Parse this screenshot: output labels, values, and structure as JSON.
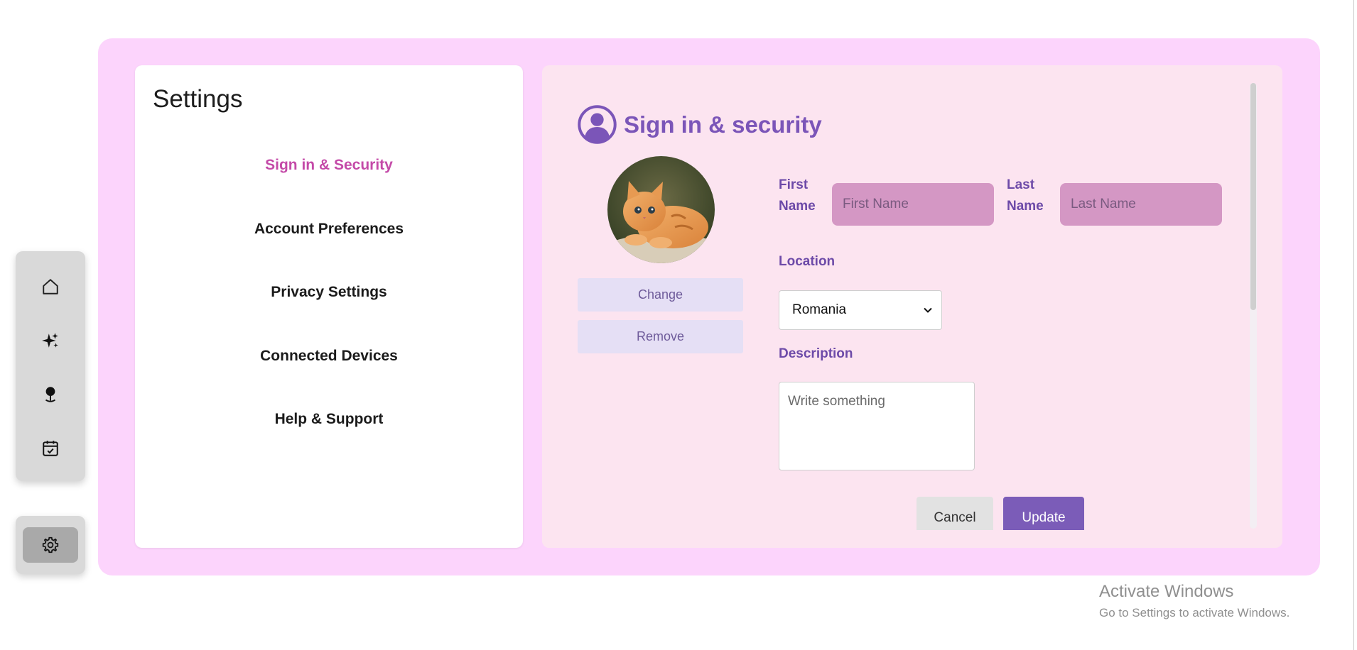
{
  "rail": {
    "icons": [
      "home-icon",
      "sparkles-icon",
      "map-pin-icon",
      "calendar-check-icon"
    ],
    "bottom_icon": "gear-icon"
  },
  "nav": {
    "title": "Settings",
    "items": [
      {
        "label": "Sign in & Security",
        "active": true
      },
      {
        "label": "Account Preferences",
        "active": false
      },
      {
        "label": "Privacy Settings",
        "active": false
      },
      {
        "label": "Connected Devices",
        "active": false
      },
      {
        "label": "Help & Support",
        "active": false
      }
    ]
  },
  "section": {
    "title": "Sign in & security",
    "icon": "user-circle-icon"
  },
  "profile": {
    "change_label": "Change",
    "remove_label": "Remove"
  },
  "form": {
    "first_name_label_1": "First",
    "first_name_label_2": "Name",
    "first_name_placeholder": "First Name",
    "last_name_label_1": "Last",
    "last_name_label_2": "Name",
    "last_name_placeholder": "Last Name",
    "location_label": "Location",
    "location_value": "Romania",
    "description_label": "Description",
    "description_placeholder": "Write something",
    "cancel_label": "Cancel",
    "update_label": "Update"
  },
  "watermark": {
    "line1": "Activate Windows",
    "line2": "Go to Settings to activate Windows."
  },
  "colors": {
    "shell": "#fcd4fc",
    "accent_purple": "#7b55b8",
    "active_nav": "#c44aa8",
    "input_fill": "#d497c4"
  }
}
